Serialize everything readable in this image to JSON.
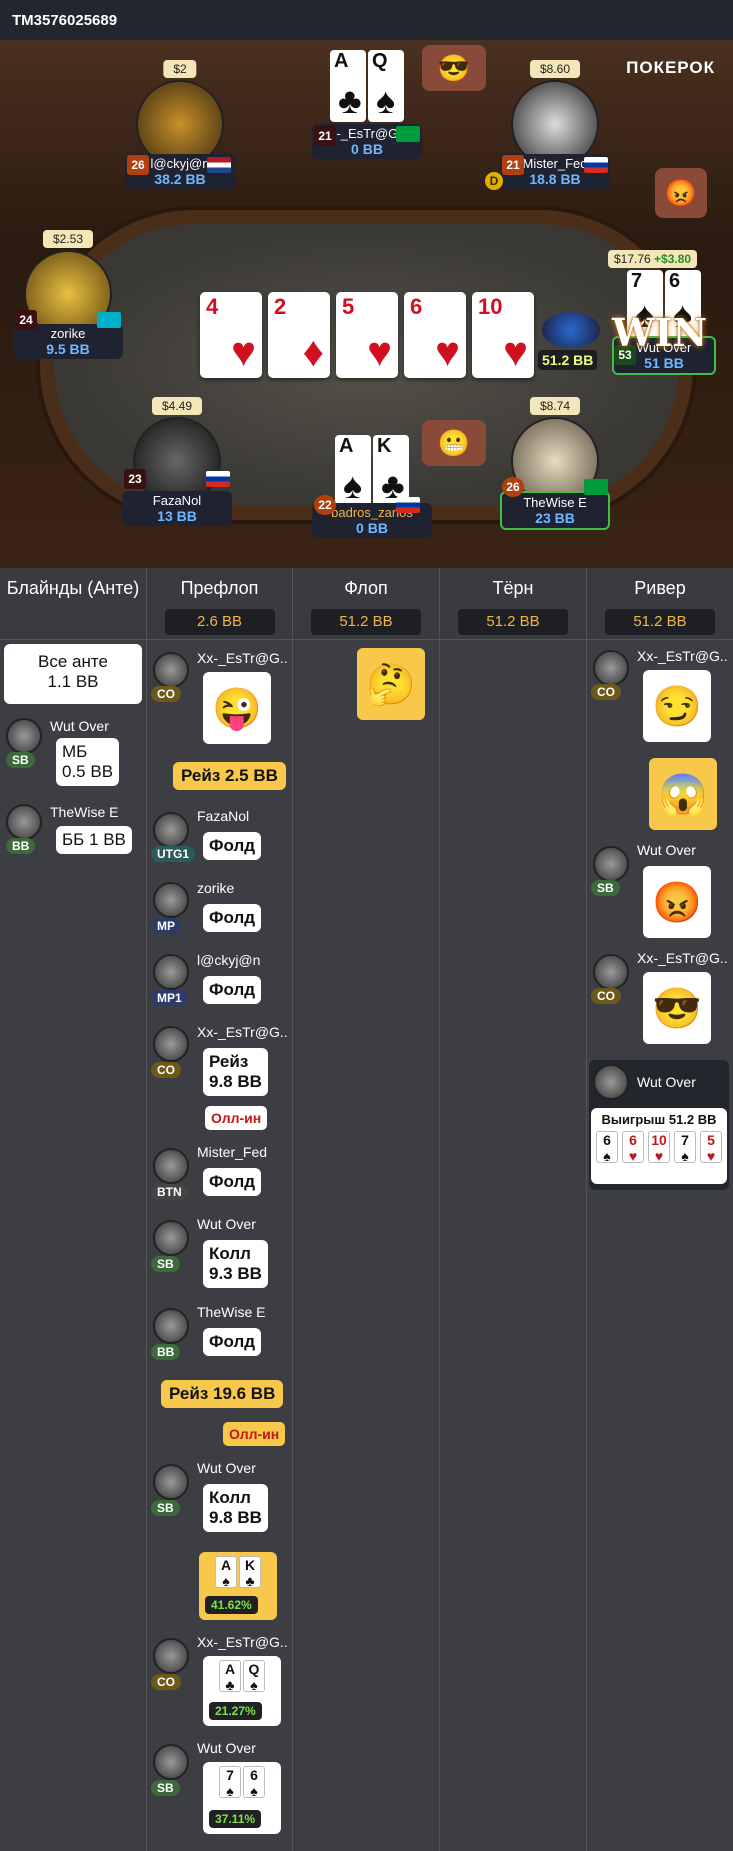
{
  "topbar": {
    "hand_id": "TM3576025689"
  },
  "brand": {
    "logo": "ПОКЕРОК"
  },
  "seats": [
    {
      "name": "l@ckyj@n",
      "stack": "38.2 BB",
      "balance": "$2",
      "level": "26",
      "flag": "nl",
      "avatar": "horseshoe"
    },
    {
      "name": "Xx-_EsTr@G0..",
      "stack": "0 BB",
      "balance": "",
      "level": "21",
      "flag": "br",
      "avatar": "cards"
    },
    {
      "name": "Mister_Fed",
      "stack": "18.8 BB",
      "balance": "$8.60",
      "level": "21",
      "flag": "ru",
      "avatar": "man"
    },
    {
      "name": "zorike",
      "stack": "9.5 BB",
      "balance": "$2.53",
      "level": "24",
      "flag": "kz",
      "avatar": "buddha"
    },
    {
      "name": "Wut Over",
      "stack": "51 BB",
      "balance": "$17.76",
      "balance_gain": "+$3.80",
      "level": "53",
      "avatar": "cards"
    },
    {
      "name": "FazaNol",
      "stack": "13 BB",
      "balance": "$4.49",
      "level": "23",
      "flag": "ru",
      "avatar": "soldier"
    },
    {
      "name": "badros_zanos",
      "stack": "0 BB",
      "balance": "",
      "level": "22",
      "flag": "ru",
      "avatar": "cards"
    },
    {
      "name": "TheWise E",
      "stack": "23 BB",
      "balance": "$8.74",
      "level": "26",
      "flag": "br",
      "avatar": "statue"
    }
  ],
  "dealer_button": "D",
  "board": [
    {
      "rank": "4",
      "suit": "♥"
    },
    {
      "rank": "2",
      "suit": "♦"
    },
    {
      "rank": "5",
      "suit": "♥"
    },
    {
      "rank": "6",
      "suit": "♥"
    },
    {
      "rank": "10",
      "suit": "♥"
    }
  ],
  "pot": "51.2 BB",
  "win_label": "WIN",
  "hole_cards": {
    "estrag": [
      {
        "rank": "A",
        "suit": "♣"
      },
      {
        "rank": "Q",
        "suit": "♠"
      }
    ],
    "badros": [
      {
        "rank": "A",
        "suit": "♠"
      },
      {
        "rank": "K",
        "suit": "♣"
      }
    ],
    "wut": [
      {
        "rank": "7",
        "suit": "♠"
      },
      {
        "rank": "6",
        "suit": "♠"
      }
    ]
  },
  "columns": [
    {
      "title": "Блайнды (Анте)",
      "value": ""
    },
    {
      "title": "Префлоп",
      "value": "2.6 BB"
    },
    {
      "title": "Флоп",
      "value": "51.2 BB"
    },
    {
      "title": "Тёрн",
      "value": "51.2 BB"
    },
    {
      "title": "Ривер",
      "value": "51.2 BB"
    }
  ],
  "blinds": {
    "all_ante": "Все анте\n1.1 BB",
    "sb_name": "Wut Over",
    "sb_pos": "SB",
    "sb_act": "МБ\n0.5 BB",
    "bb_name": "TheWise E",
    "bb_pos": "BB",
    "bb_act": "ББ 1 BB"
  },
  "preflop": [
    {
      "name": "Xx-_EsTr@G..",
      "pos": "CO",
      "emote": "😜"
    },
    {
      "raise": "Рейз 2.5 BB"
    },
    {
      "name": "FazaNol",
      "pos": "UTG1",
      "act": "Фолд"
    },
    {
      "name": "zorike",
      "pos": "MP",
      "act": "Фолд"
    },
    {
      "name": "l@ckyj@n",
      "pos": "MP1",
      "act": "Фолд"
    },
    {
      "name": "Xx-_EsTr@G..",
      "pos": "CO",
      "act": "Рейз\n9.8 BB",
      "allin": "Олл-ин"
    },
    {
      "name": "Mister_Fed",
      "pos": "BTN",
      "act": "Фолд"
    },
    {
      "name": "Wut Over",
      "pos": "SB",
      "act": "Колл\n9.3 BB"
    },
    {
      "name": "TheWise E",
      "pos": "BB",
      "act": "Фолд"
    },
    {
      "raise": "Рейз 19.6 BB",
      "allin": "Олл-ин"
    },
    {
      "name": "Wut Over",
      "pos": "SB",
      "act": "Колл\n9.8 BB"
    },
    {
      "cards": "AK",
      "pct": "41.62%"
    },
    {
      "name": "Xx-_EsTr@G..",
      "pos": "CO",
      "cards": "AQ",
      "pct": "21.27%"
    },
    {
      "name": "Wut Over",
      "pos": "SB",
      "cards": "76",
      "pct": "37.11%"
    }
  ],
  "river": [
    {
      "name": "Xx-_EsTr@G..",
      "pos": "CO"
    },
    {
      "name": "Wut Over",
      "pos": "SB"
    },
    {
      "name": "Xx-_EsTr@G..",
      "pos": "CO"
    },
    {
      "name": "Wut Over",
      "win": "Выигрыш 51.2 BB"
    }
  ],
  "winning_hand": [
    {
      "rank": "6",
      "suit": "♠"
    },
    {
      "rank": "6",
      "suit": "♥"
    },
    {
      "rank": "10",
      "suit": "♥"
    },
    {
      "rank": "7",
      "suit": "♠"
    },
    {
      "rank": "5",
      "suit": "♥"
    }
  ]
}
